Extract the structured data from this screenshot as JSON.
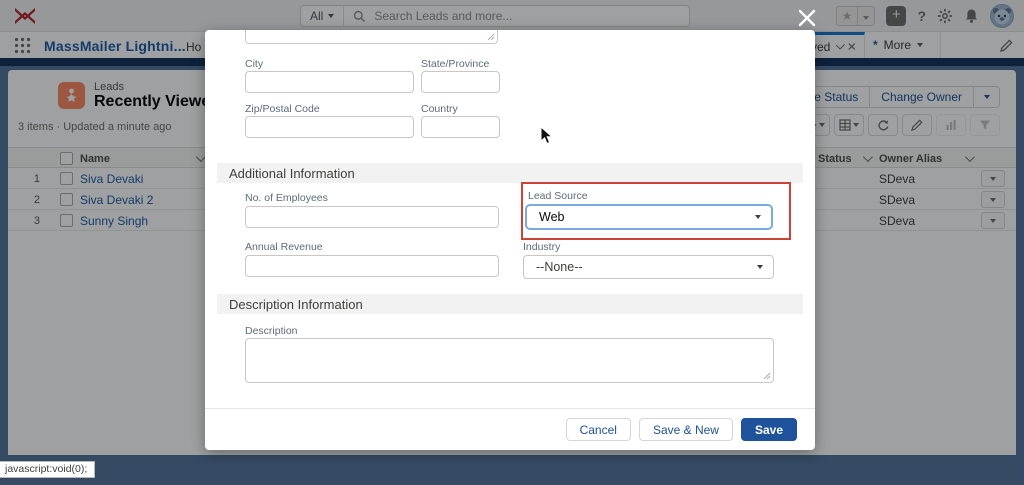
{
  "header": {
    "search": {
      "scope_label": "All",
      "placeholder": "Search Leads and more..."
    },
    "glyphs": {
      "help": "?",
      "star": "★",
      "plus": "+"
    }
  },
  "nav": {
    "app_name": "MassMailer Lightni...",
    "home_tab_partial": "Ho",
    "workspace_tab_partial": "ved",
    "more_tab_label": "More",
    "more_tab_indicator": "*"
  },
  "list": {
    "entity_label": "Leads",
    "view_name": "Recently Viewed",
    "summary": "3 items · Updated a minute ago",
    "actions": {
      "change_status": "Change Status",
      "change_owner": "Change Owner"
    },
    "columns": {
      "name": "Name",
      "status": "Status",
      "owner_alias": "Owner Alias"
    },
    "rows": [
      {
        "num": "1",
        "name": "Siva Devaki",
        "status": "",
        "owner_alias": "SDeva"
      },
      {
        "num": "2",
        "name": "Siva Devaki 2",
        "status": "",
        "owner_alias": "SDeva"
      },
      {
        "num": "3",
        "name": "Sunny Singh",
        "status": "",
        "owner_alias": "SDeva"
      }
    ]
  },
  "modal": {
    "address": {
      "city_label": "City",
      "state_label": "State/Province",
      "zip_label": "Zip/Postal Code",
      "country_label": "Country"
    },
    "sections": {
      "additional": "Additional Information",
      "description": "Description Information"
    },
    "fields": {
      "employees_label": "No. of Employees",
      "lead_source_label": "Lead Source",
      "lead_source_value": "Web",
      "annual_revenue_label": "Annual Revenue",
      "industry_label": "Industry",
      "industry_value": "--None--",
      "description_label": "Description"
    },
    "buttons": {
      "cancel": "Cancel",
      "save_new": "Save & New",
      "save": "Save"
    }
  },
  "status_bar": {
    "text": "javascript:void(0);"
  },
  "colors": {
    "accent_blue": "#0070d2",
    "brand_navy": "#16325c",
    "save_blue": "#1e539b",
    "annotation_red": "#cb4337",
    "lead_icon_orange": "#f88962"
  }
}
